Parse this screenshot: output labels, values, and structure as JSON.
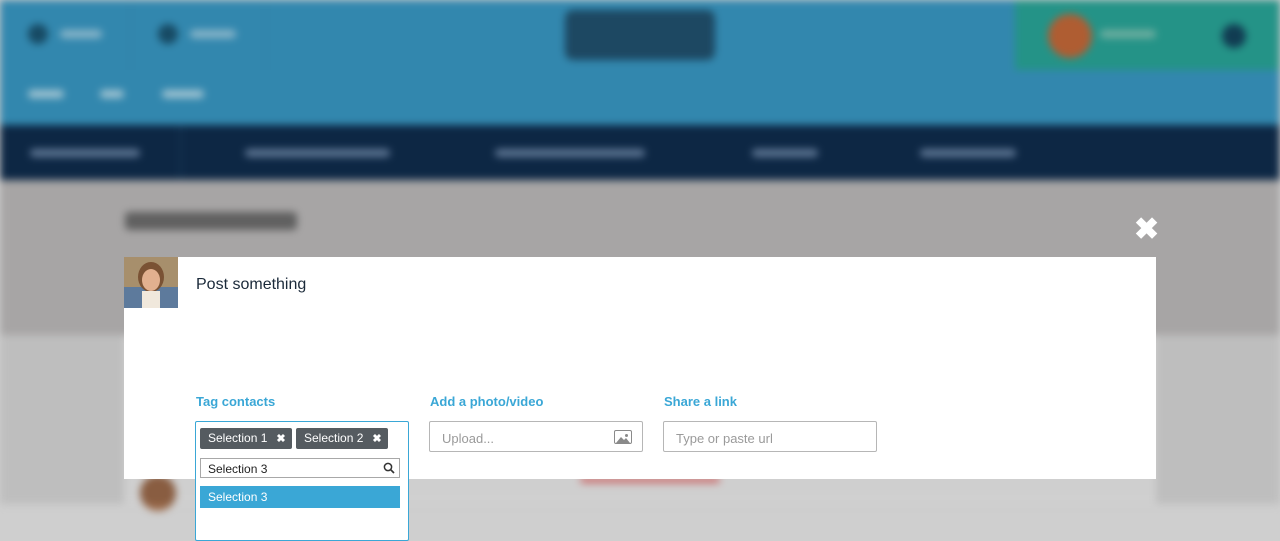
{
  "modal": {
    "prompt": "Post something",
    "close_glyph": "✖",
    "columns": {
      "tag_contacts": {
        "label": "Tag contacts"
      },
      "add_media": {
        "label": "Add a photo/video",
        "placeholder": "Upload..."
      },
      "share_link": {
        "label": "Share a link",
        "placeholder": "Type or paste url"
      }
    },
    "tags": {
      "selected": [
        {
          "label": "Selection 1",
          "remove": "✖"
        },
        {
          "label": "Selection 2",
          "remove": "✖"
        }
      ],
      "search_value": "Selection 3",
      "dropdown_options": [
        "Selection 3"
      ]
    }
  },
  "colors": {
    "accent": "#3aa7d6",
    "header_bg": "#3a9ac6",
    "nav_bg": "#0f2d4e",
    "chip_bg": "#555b60"
  },
  "icons": [
    "close-icon",
    "image-icon",
    "search-icon",
    "remove-tag-icon"
  ]
}
